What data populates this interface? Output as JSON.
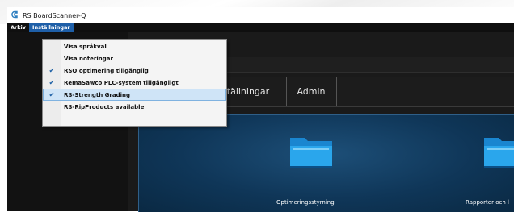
{
  "window": {
    "title": "RS BoardScanner-Q",
    "icon": "rs-logo-icon"
  },
  "menubar": {
    "items": [
      {
        "label": "Arkiv"
      },
      {
        "label": "Inställningar"
      }
    ]
  },
  "dropdown": {
    "items": [
      {
        "label": "Visa språkval",
        "checked": false,
        "check": ""
      },
      {
        "label": "Visa noteringar",
        "checked": false,
        "check": ""
      },
      {
        "label": "RSQ optimering tillgänglig",
        "checked": true,
        "check": "✔"
      },
      {
        "label": "RemaSawco PLC-system tillgängligt",
        "checked": true,
        "check": "✔"
      },
      {
        "label": "RS-Strength Grading",
        "checked": true,
        "check": "✔",
        "highlighted": true
      },
      {
        "label": "RS-RipProducts available",
        "checked": false,
        "check": ""
      }
    ]
  },
  "tabs": [
    {
      "label": "Inställningar"
    },
    {
      "label": "Admin"
    }
  ],
  "tiles": [
    {
      "label": "Optimeringsstyrning",
      "icon": "folder-icon"
    },
    {
      "label": "Rapporter och l",
      "icon": "folder-icon"
    }
  ],
  "colors": {
    "menu_active": "#1e5fa8",
    "content_bg": "#0f3658",
    "highlight": "#cfe4f7",
    "check": "#1b5fa5"
  }
}
